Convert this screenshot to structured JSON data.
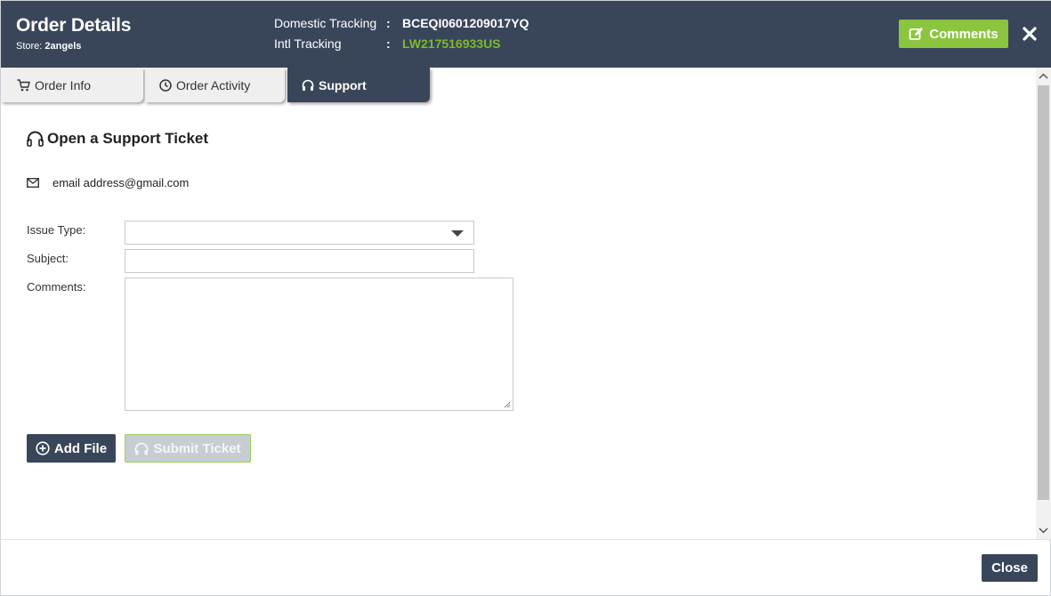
{
  "header": {
    "title": "Order Details",
    "store_prefix": "Store:",
    "store_name": "2angels",
    "domestic_label": "Domestic Tracking",
    "domestic_value": "BCEQI0601209017YQ",
    "intl_label": "Intl Tracking",
    "intl_value": "LW217516933US",
    "colon": ":",
    "comments_label": "Comments",
    "close_icon": "close-icon"
  },
  "tabs": [
    {
      "label": "Order Info",
      "icon": "cart-icon"
    },
    {
      "label": "Order Activity",
      "icon": "clock-icon"
    },
    {
      "label": "Support",
      "icon": "headphones-icon",
      "active": true
    }
  ],
  "support": {
    "title": "Open a Support Ticket",
    "email": "email address@gmail.com",
    "issue_type_label": "Issue Type:",
    "issue_type_value": "",
    "subject_label": "Subject:",
    "subject_value": "",
    "comments_label": "Comments:",
    "comments_value": "",
    "add_file_label": "Add File",
    "submit_label": "Submit Ticket"
  },
  "footer": {
    "close_label": "Close"
  },
  "colors": {
    "header_bg": "#39465a",
    "accent_green": "#8bc53f",
    "tracking_green": "#7dba2b"
  }
}
